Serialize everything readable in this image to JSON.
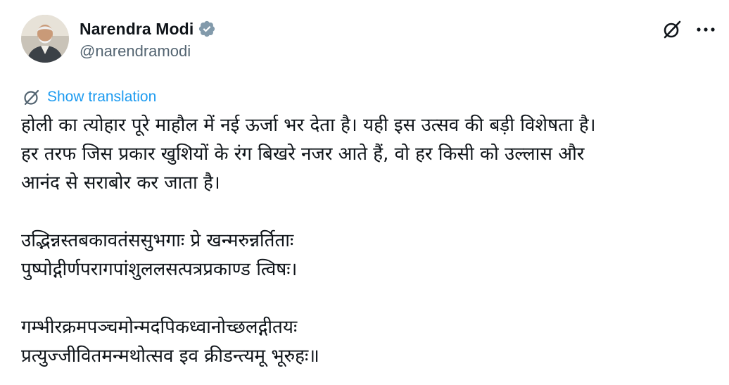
{
  "author": {
    "display_name": "Narendra Modi",
    "handle": "@narendramodi",
    "verified": true,
    "verified_color": "#829aab"
  },
  "actions": {
    "grok_icon": "grok-icon",
    "more_icon": "more-horizontal-icon"
  },
  "translation": {
    "label": "Show translation",
    "icon": "translate-globe-icon",
    "color": "#1d9bf0"
  },
  "tweet": {
    "paragraph_1": [
      "होली का त्योहार पूरे माहौल में नई ऊर्जा भर देता है। यही इस उत्सव की बड़ी विशेषता है।",
      "हर तरफ जिस प्रकार खुशियों के रंग बिखरे नजर आते हैं, वो हर किसी को उल्लास और",
      "आनंद से सराबोर कर जाता है।"
    ],
    "paragraph_2": [
      "उद्भिन्नस्तबकावतंससुभगाः प्रे खन्मरुन्नर्तिताः",
      "पुष्पोद्गीर्णपरागपांशुललसत्पत्रप्रकाण्ड त्विषः।"
    ],
    "paragraph_3": [
      "गम्भीरक्रमपञ्चमोन्मदपिकध्वानोच्छलद्गीतयः",
      "प्रत्युज्जीवितमन्मथोत्सव इव क्रीडन्त्यमू भूरुहः॥"
    ]
  }
}
